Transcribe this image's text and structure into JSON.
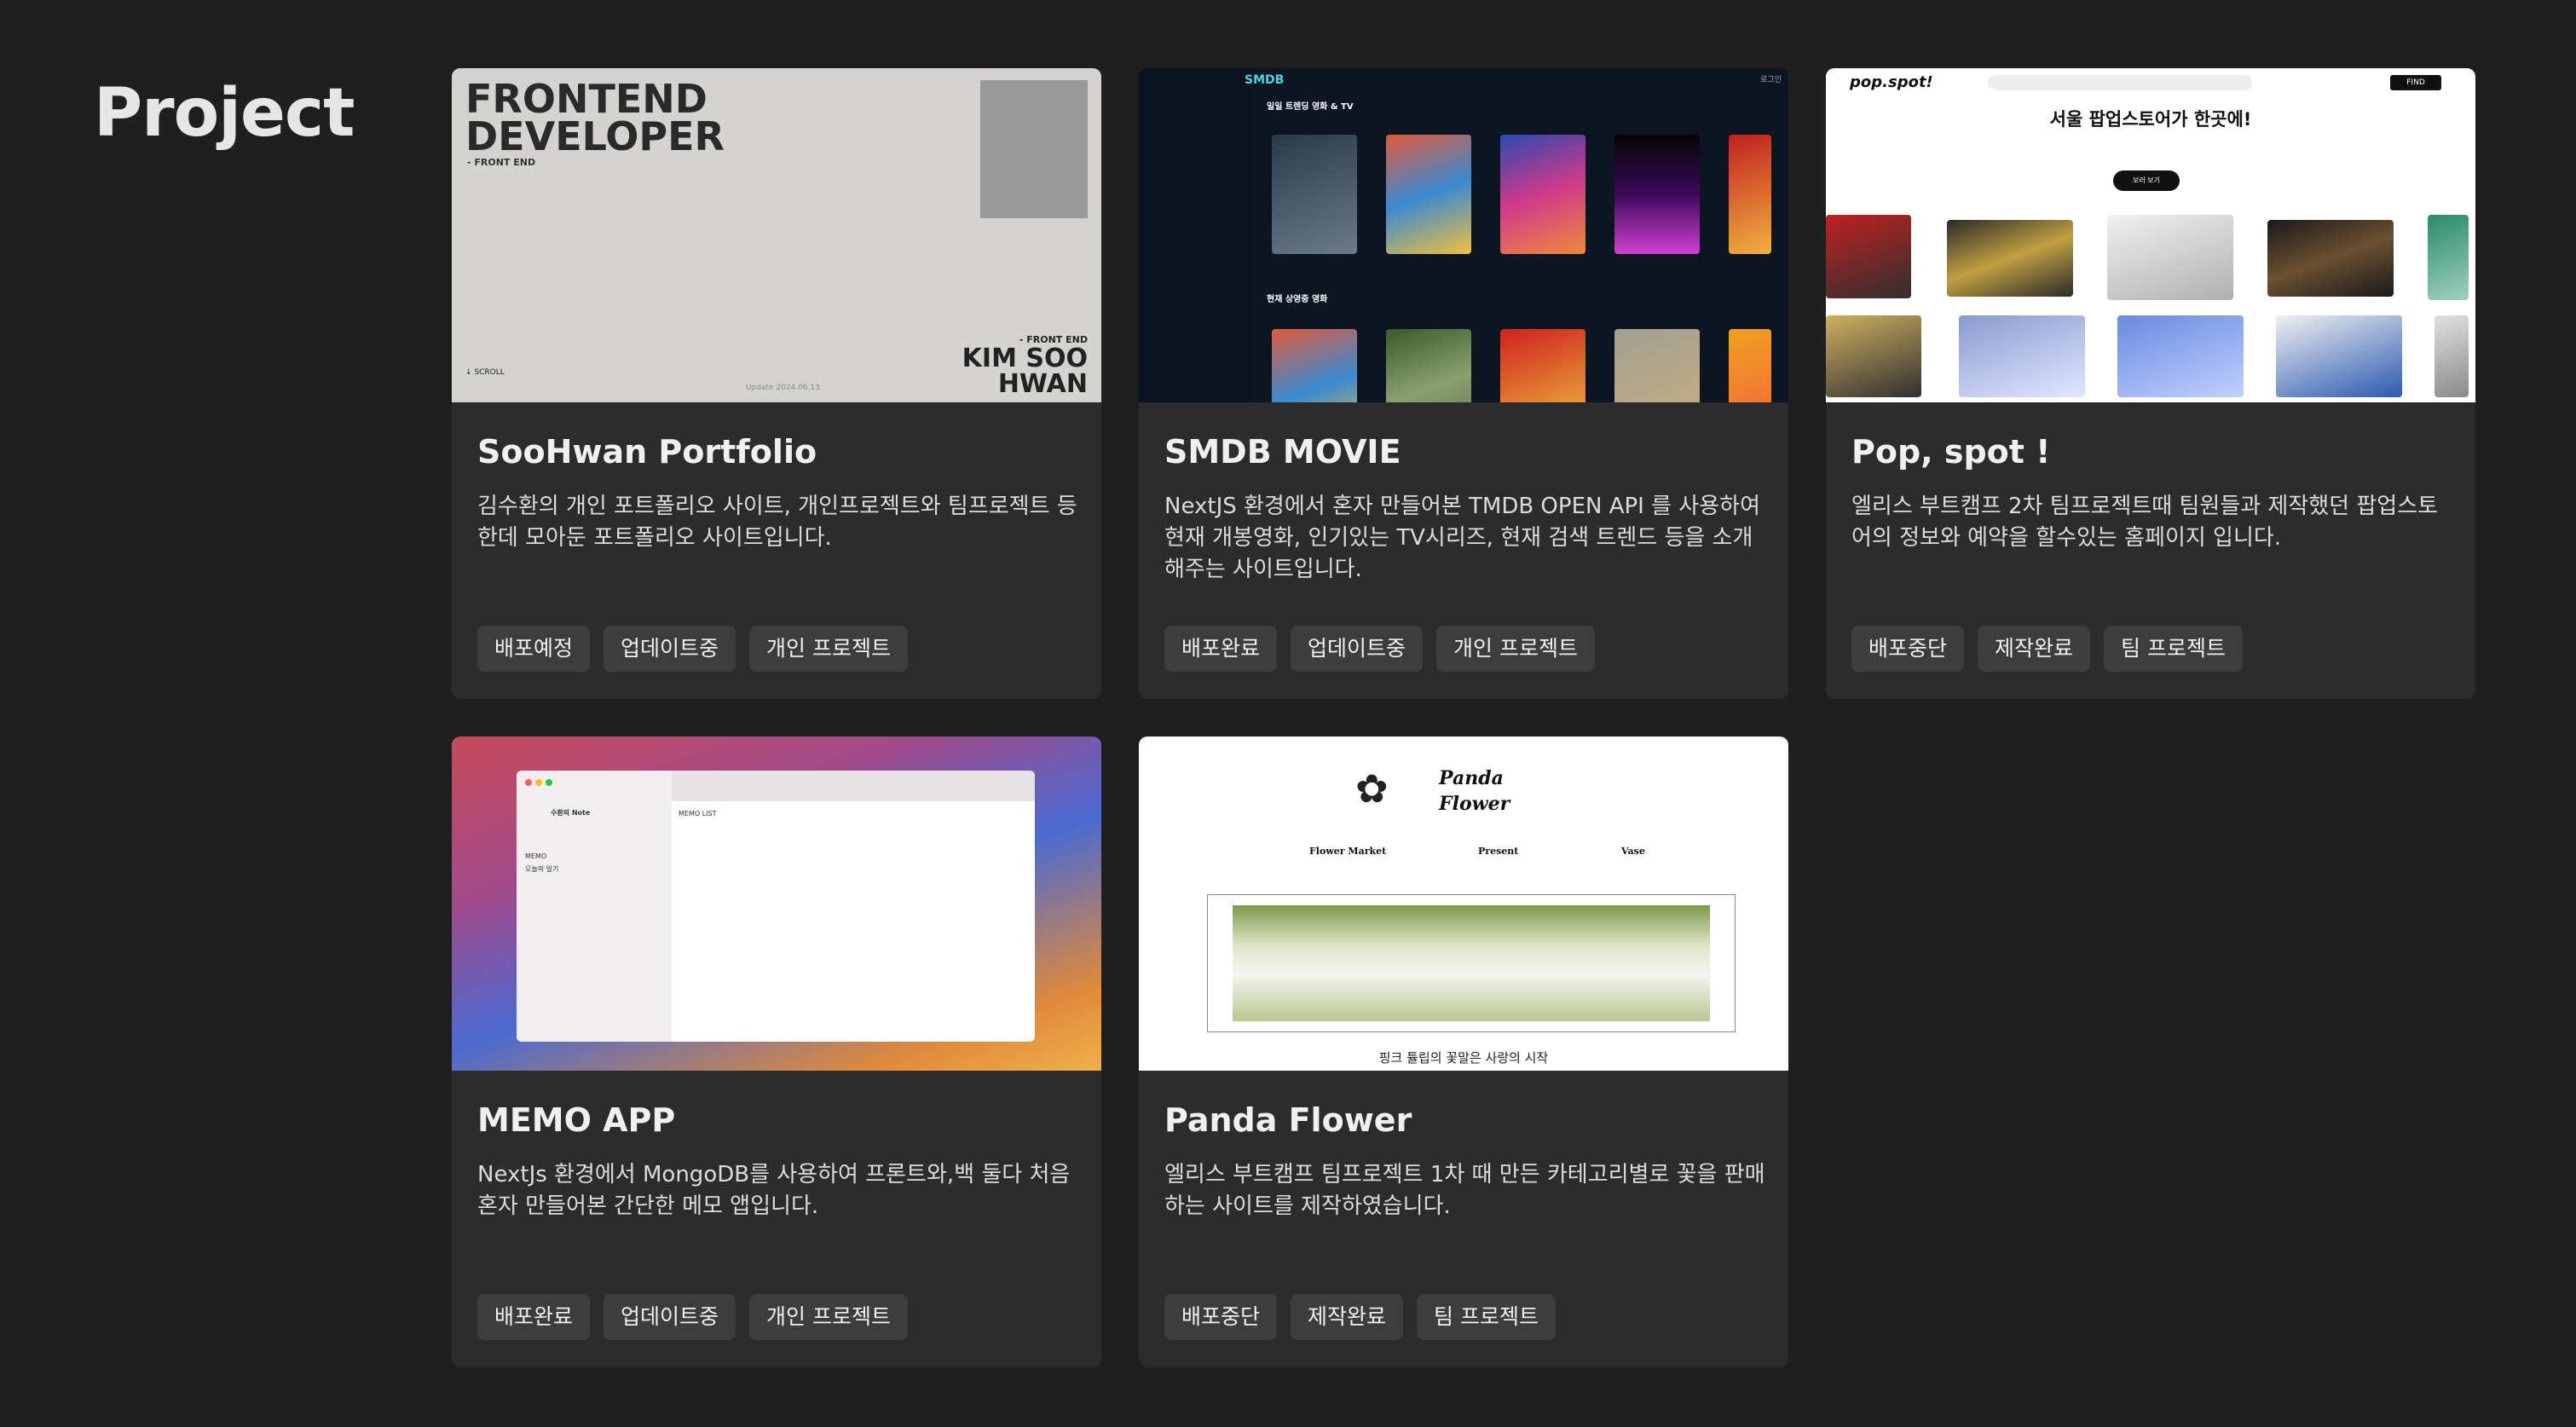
{
  "section_title": "Project",
  "projects": [
    {
      "title": "SooHwan Portfolio",
      "desc": "김수환의 개인 포트폴리오 사이트, 개인프로젝트와 팀프로젝트 등 한데 모아둔 포트폴리오 사이트입니다.",
      "tags": [
        "배포예정",
        "업데이트중",
        "개인 프로젝트"
      ],
      "thumb": {
        "headline": "FRONTEND DEVELOPER",
        "sub": "- FRONT END",
        "fe": "- FRONT END",
        "name": "KIM SOO HWAN",
        "scroll": "↓ SCROLL",
        "update": "Update 2024.06.13"
      }
    },
    {
      "title": "SMDB MOVIE",
      "desc": "NextJS 환경에서 혼자 만들어본 TMDB OPEN API 를 사용하여 현재 개봉영화, 인기있는 TV시리즈, 현재 검색 트렌드 등을 소개해주는 사이트입니다.",
      "tags": [
        "배포완료",
        "업데이트중",
        "개인 프로젝트"
      ],
      "thumb": {
        "logo": "SMDB",
        "login": "로그인",
        "row1": "일일 트렌딩 영화 & TV",
        "row2": "현재 상영중 영화"
      }
    },
    {
      "title": "Pop, spot !",
      "desc": "엘리스 부트캠프 2차 팀프로젝트때 팀원들과 제작했던 팝업스토어의 정보와 예약을 할수있는 홈페이지 입니다.",
      "tags": [
        "배포중단",
        "제작완료",
        "팀 프로젝트"
      ],
      "thumb": {
        "brand": "pop.spot!",
        "find": "FIND",
        "headline": "서울 팝업스토어가 한곳에!",
        "pill": "보러 보기"
      }
    },
    {
      "title": "MEMO APP",
      "desc": "NextJs 환경에서 MongoDB를 사용하여 프론트와,백 둘다 처음 혼자 만들어본 간단한 메모 앱입니다.",
      "tags": [
        "배포완료",
        "업데이트중",
        "개인 프로젝트"
      ],
      "thumb": {
        "user": "수환의 Note",
        "list": "MEMO LIST",
        "folder1": "MEMO",
        "folder2": "오늘의 일기"
      }
    },
    {
      "title": "Panda Flower",
      "desc": "엘리스 부트캠프 팀프로젝트 1차 때 만든 카테고리별로 꽃을 판매하는 사이트를 제작하였습니다.",
      "tags": [
        "배포중단",
        "제작완료",
        "팀 프로젝트"
      ],
      "thumb": {
        "title1": "Panda",
        "title2": "Flower",
        "nav1": "Flower Market",
        "nav2": "Present",
        "nav3": "Vase",
        "caption": "핑크 튤립의 꽃말은 사랑의 시작"
      }
    }
  ]
}
